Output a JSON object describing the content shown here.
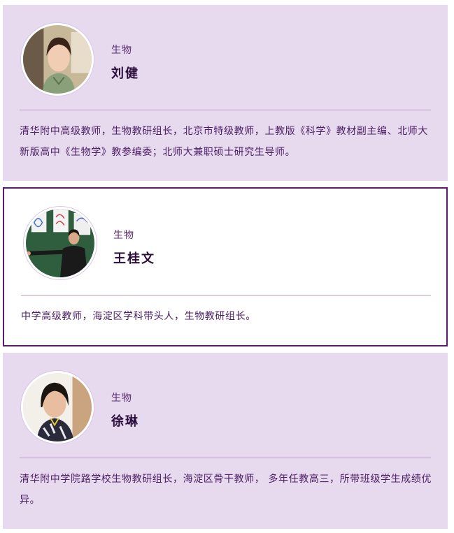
{
  "teachers": [
    {
      "subject": "生物",
      "name": "刘健",
      "bio": "清华附中高级教师，生物教研组长，北京市特级教师，上教版《科学》教材副主编、北师大新版高中《生物学》教参编委；北师大兼职硕士研究生导师。"
    },
    {
      "subject": "生物",
      "name": "王桂文",
      "bio": "中学高级教师，海淀区学科带头人，生物教研组长。"
    },
    {
      "subject": "生物",
      "name": "徐琳",
      "bio": "清华附中学院路学校生物教研组长，海淀区骨干教师， 多年任教高三，所带班级学生成绩优异。"
    }
  ],
  "colors": {
    "card_fill": "#e7d9ee",
    "card_border": "#5b1a6e",
    "name_text": "#2b0f3c",
    "body_text": "#4a1e63"
  }
}
